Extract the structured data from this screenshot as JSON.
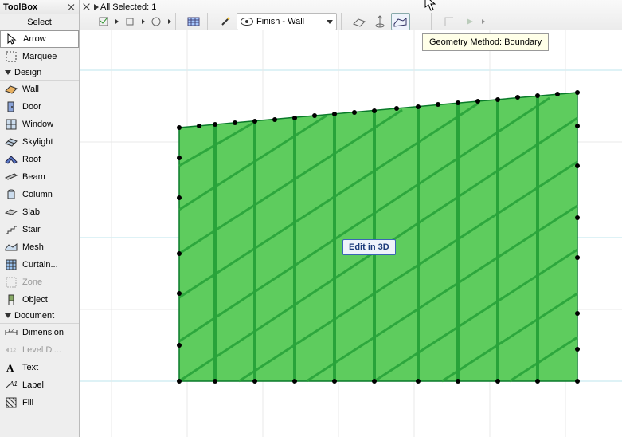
{
  "toolbox": {
    "title": "ToolBox",
    "section_select": "Select",
    "heading_design": "Design",
    "heading_document": "Document",
    "items_select": [
      {
        "label": "Arrow",
        "icon": "arrow"
      },
      {
        "label": "Marquee",
        "icon": "marquee"
      }
    ],
    "items_design": [
      {
        "label": "Wall",
        "icon": "wall"
      },
      {
        "label": "Door",
        "icon": "door"
      },
      {
        "label": "Window",
        "icon": "window"
      },
      {
        "label": "Skylight",
        "icon": "skylight"
      },
      {
        "label": "Roof",
        "icon": "roof"
      },
      {
        "label": "Beam",
        "icon": "beam"
      },
      {
        "label": "Column",
        "icon": "column"
      },
      {
        "label": "Slab",
        "icon": "slab"
      },
      {
        "label": "Stair",
        "icon": "stair"
      },
      {
        "label": "Mesh",
        "icon": "mesh"
      },
      {
        "label": "Curtain...",
        "icon": "curtain"
      },
      {
        "label": "Zone",
        "icon": "zone",
        "disabled": true
      },
      {
        "label": "Object",
        "icon": "object"
      }
    ],
    "items_document": [
      {
        "label": "Dimension",
        "icon": "dim"
      },
      {
        "label": "Level Di...",
        "icon": "level",
        "disabled": true
      },
      {
        "label": "Text",
        "icon": "text"
      },
      {
        "label": "Label",
        "icon": "label"
      },
      {
        "label": "Fill",
        "icon": "fill"
      }
    ]
  },
  "topbar": {
    "selected_info": "All Selected: 1",
    "finish_label": "Finish - Wall",
    "tooltip": "Geometry Method: Boundary"
  },
  "canvas": {
    "badge": "Edit in 3D"
  }
}
